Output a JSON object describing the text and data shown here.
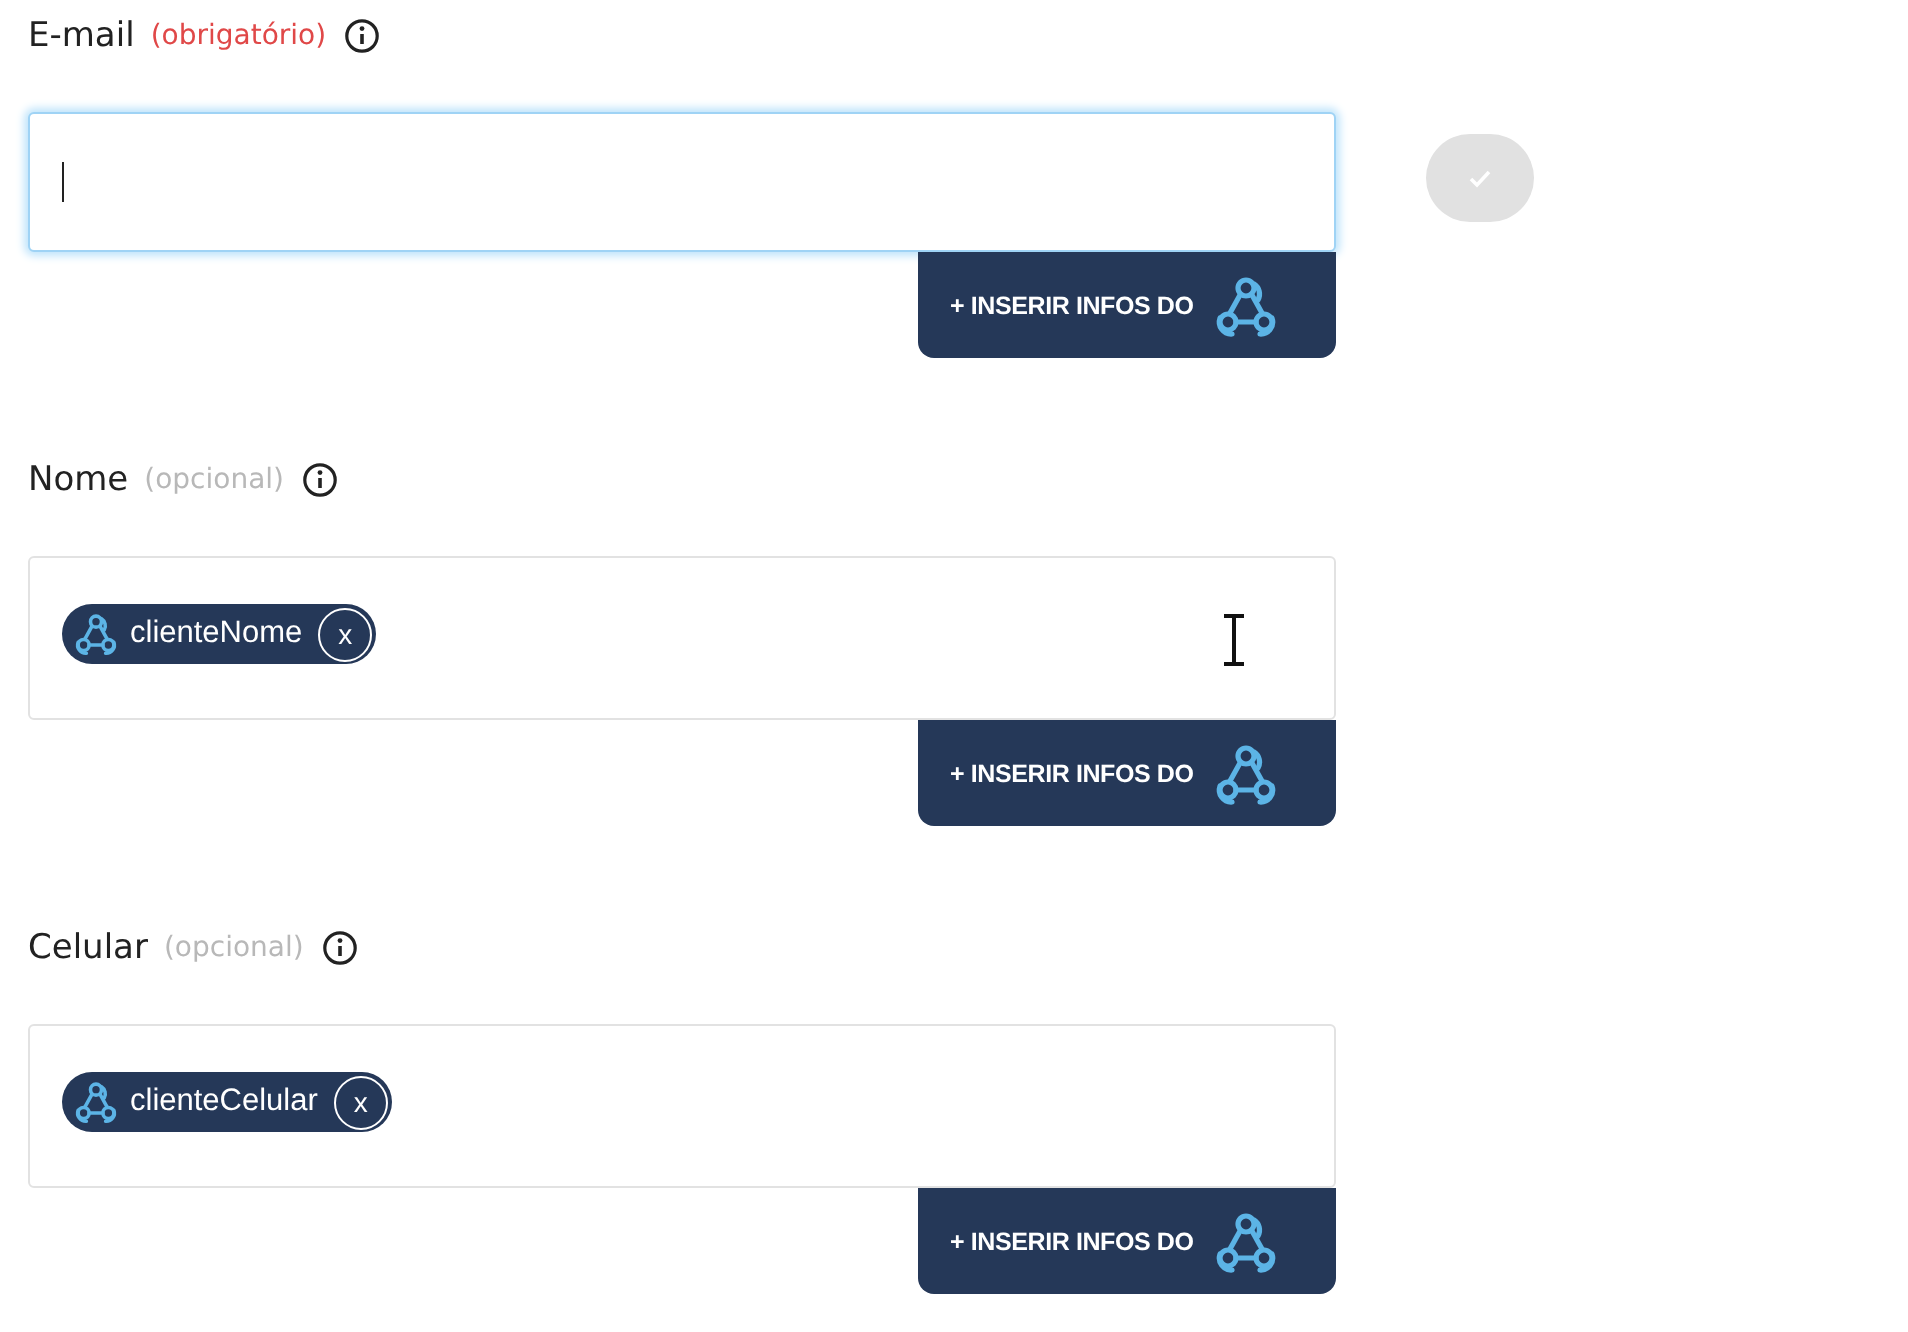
{
  "fields": [
    {
      "kind": "email",
      "label": "E-mail",
      "requirement": "(obrigatório)",
      "required": true,
      "focused": true,
      "button": "+ INSERIR INFOS DO",
      "confirm": {
        "disabled": true
      }
    },
    {
      "kind": "tags",
      "label": "Nome",
      "requirement": "(opcional)",
      "required": false,
      "focused": false,
      "tags": [
        {
          "label": "clienteNome",
          "remove": "x"
        }
      ],
      "button": "+ INSERIR INFOS DO"
    },
    {
      "kind": "tags",
      "label": "Celular",
      "requirement": "(opcional)",
      "required": false,
      "focused": false,
      "tags": [
        {
          "label": "clienteCelular",
          "remove": "x"
        }
      ],
      "button": "+ INSERIR INFOS DO"
    }
  ]
}
